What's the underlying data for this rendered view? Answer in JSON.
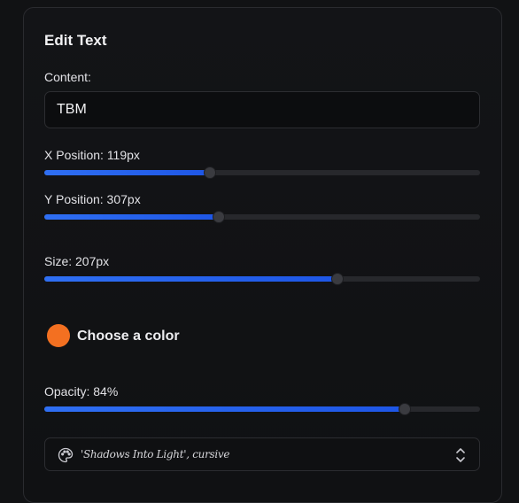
{
  "editor": {
    "title": "Edit Text",
    "content_label": "Content:",
    "content_value": "TBM",
    "x_position_label": "X Position: 119px",
    "x_position": {
      "value": 119,
      "fraction": 0.38
    },
    "y_position_label": "Y Position: 307px",
    "y_position": {
      "value": 307,
      "fraction": 0.4
    },
    "size_label": "Size: 207px",
    "size": {
      "value": 207,
      "fraction": 0.673
    },
    "color_label": "Choose a color",
    "color_value": "#f37021",
    "opacity_label": "Opacity: 84%",
    "opacity": {
      "value": 84,
      "fraction": 0.828
    },
    "font_value": "'Shadows Into Light', cursive"
  },
  "colors": {
    "accent": "#1e56e6",
    "swatch": "#f37021",
    "background": "#111214"
  },
  "icons": {
    "font_select_icon": "palette-icon",
    "font_select_chevron": "chevrons-up-down-icon"
  }
}
